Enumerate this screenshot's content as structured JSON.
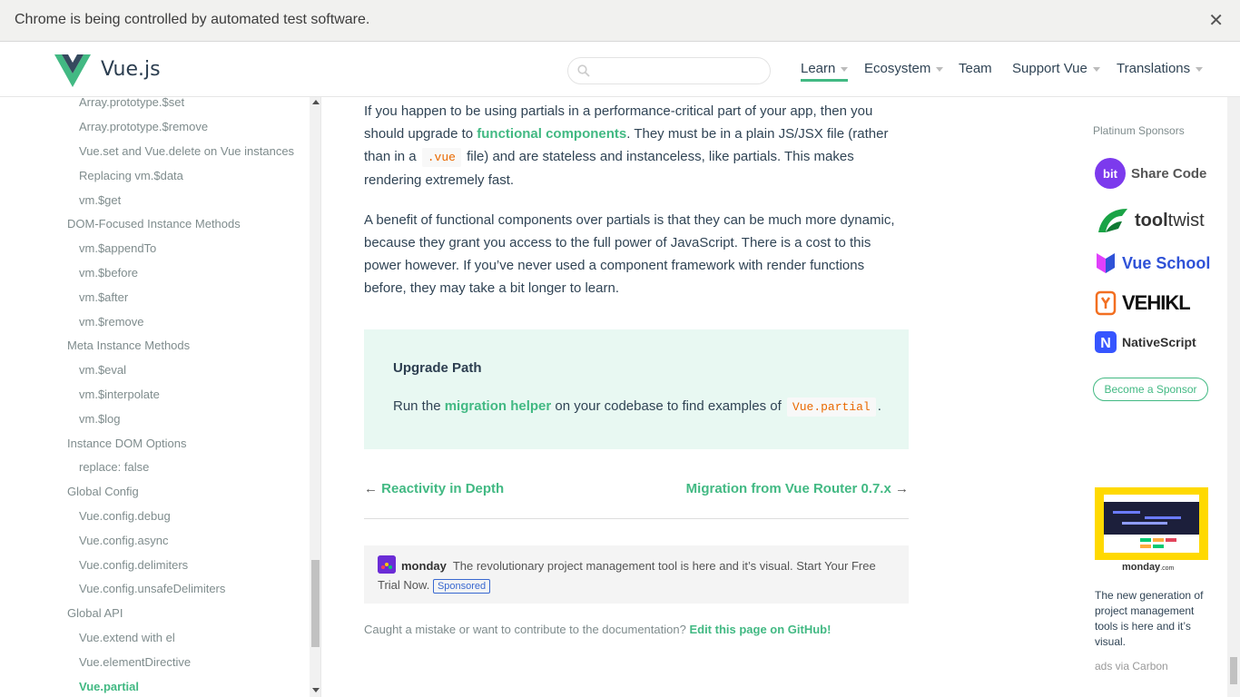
{
  "infobar": {
    "message": "Chrome is being controlled by automated test software.",
    "close_glyph": "✕"
  },
  "header": {
    "logo_text": "Vue.js",
    "search_placeholder": "",
    "nav": [
      {
        "label": "Learn",
        "active": true,
        "dropdown": true
      },
      {
        "label": "Ecosystem",
        "dropdown": true
      },
      {
        "label": "Team",
        "dropdown": false
      },
      {
        "label": "Support Vue",
        "dropdown": true
      },
      {
        "label": "Translations",
        "dropdown": true
      }
    ]
  },
  "sidebar": {
    "items": [
      {
        "label": "Array.prototype.$set",
        "level": 2
      },
      {
        "label": "Array.prototype.$remove",
        "level": 2
      },
      {
        "label": "Vue.set and Vue.delete on Vue instances",
        "level": 2
      },
      {
        "label": "Replacing vm.$data",
        "level": 2
      },
      {
        "label": "vm.$get",
        "level": 2
      },
      {
        "label": "DOM-Focused Instance Methods",
        "level": 1
      },
      {
        "label": "vm.$appendTo",
        "level": 2
      },
      {
        "label": "vm.$before",
        "level": 2
      },
      {
        "label": "vm.$after",
        "level": 2
      },
      {
        "label": "vm.$remove",
        "level": 2
      },
      {
        "label": "Meta Instance Methods",
        "level": 1
      },
      {
        "label": "vm.$eval",
        "level": 2
      },
      {
        "label": "vm.$interpolate",
        "level": 2
      },
      {
        "label": "vm.$log",
        "level": 2
      },
      {
        "label": "Instance DOM Options",
        "level": 1
      },
      {
        "label": "replace: false",
        "level": 2
      },
      {
        "label": "Global Config",
        "level": 1
      },
      {
        "label": "Vue.config.debug",
        "level": 2
      },
      {
        "label": "Vue.config.async",
        "level": 2
      },
      {
        "label": "Vue.config.delimiters",
        "level": 2
      },
      {
        "label": "Vue.config.unsafeDelimiters",
        "level": 2
      },
      {
        "label": "Global API",
        "level": 1
      },
      {
        "label": "Vue.extend with el",
        "level": 2
      },
      {
        "label": "Vue.elementDirective",
        "level": 2
      },
      {
        "label": "Vue.partial",
        "level": 2,
        "active": true
      }
    ]
  },
  "main": {
    "p1": {
      "before": "If you happen to be using partials in a performance-critical part of your app, then you should upgrade to ",
      "link": "functional components",
      "middle": ". They must be in a plain JS/JSX file (rather than in a ",
      "code": ".vue",
      "after": " file) and are stateless and instanceless, like partials. This makes rendering extremely fast."
    },
    "p2": "A benefit of functional components over partials is that they can be much more dynamic, because they grant you access to the full power of JavaScript. There is a cost to this power however. If you’ve never used a component framework with render functions before, they may take a bit longer to learn.",
    "tip": {
      "title": "Upgrade Path",
      "before": "Run the ",
      "link": "migration helper",
      "middle": " on your codebase to find examples of ",
      "code": "Vue.partial",
      "after": "."
    },
    "prev": {
      "arrow": "←",
      "label": "Reactivity in Depth"
    },
    "next": {
      "arrow": "→",
      "label": "Migration from Vue Router 0.7.x"
    },
    "ad": {
      "brand": "monday",
      "text": "The revolutionary project management tool is here and it’s visual. Start Your Free Trial Now.",
      "tag": "Sponsored"
    },
    "footer": {
      "text": "Caught a mistake or want to contribute to the documentation?",
      "link": "Edit this page on GitHub!"
    }
  },
  "aside": {
    "title": "Platinum Sponsors",
    "sponsors": [
      {
        "name": "Share Code",
        "icon": "bit-icon",
        "icon_text": "bit",
        "color": "#7c3aed"
      },
      {
        "name_a": "tool",
        "name_b": "twist",
        "icon": "tooltwist-icon",
        "color": "#1aa346"
      },
      {
        "name": "Vue School",
        "icon": "vueschool-icon",
        "color": "#2f52d7"
      },
      {
        "name": "VEHIKL",
        "icon": "vehikl-icon",
        "color": "#f26f21"
      },
      {
        "name": "NativeScript",
        "icon": "nativescript-icon",
        "icon_text": "N",
        "color": "#3655ff"
      }
    ],
    "become": "Become a Sponsor",
    "carbon": {
      "brand": "monday",
      "brand_suffix": ".com",
      "text": "The new generation of project management tools is here and it’s visual.",
      "via": "ads via Carbon"
    }
  }
}
